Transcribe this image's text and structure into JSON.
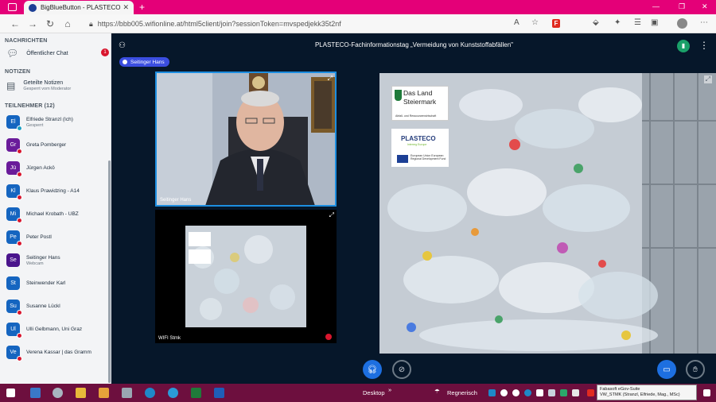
{
  "browser": {
    "tab_title": "BigBlueButton - PLASTECO -",
    "url": "https://bbb005.wifionline.at/html5client/join?sessionToken=mvspedjekk35t2nf"
  },
  "sidebar": {
    "messages_header": "NACHRICHTEN",
    "public_chat": "Öffentlicher Chat",
    "unread": "1",
    "notes_header": "NOTIZEN",
    "shared_notes": "Geteilte Notizen",
    "shared_notes_sub": "Gesperrt vom Moderator",
    "participants_header": "TEILNEHMER (12)",
    "users": [
      {
        "initials": "El",
        "name": "Elfriede Stranzl (Ich)",
        "sub": "Gesperrt",
        "color": "#1565c0",
        "mic": "on"
      },
      {
        "initials": "Gr",
        "name": "Greta Pomberger",
        "sub": "",
        "color": "#6a1b9a",
        "mic": "muted"
      },
      {
        "initials": "Jü",
        "name": "Jürgen Ackö",
        "sub": "",
        "color": "#6a1b9a",
        "mic": "muted"
      },
      {
        "initials": "Kl",
        "name": "Klaus Prawidzing - A14",
        "sub": "",
        "color": "#1565c0",
        "mic": "muted"
      },
      {
        "initials": "Mi",
        "name": "Michael Krobath - UBZ",
        "sub": "",
        "color": "#1565c0",
        "mic": "muted"
      },
      {
        "initials": "Pe",
        "name": "Peter Postl",
        "sub": "",
        "color": "#1565c0",
        "mic": "muted"
      },
      {
        "initials": "Se",
        "name": "Seitinger Hans",
        "sub": "Webcam",
        "color": "#4a148c",
        "mic": "none"
      },
      {
        "initials": "St",
        "name": "Steinwender Karl",
        "sub": "",
        "color": "#1565c0",
        "mic": "none"
      },
      {
        "initials": "Su",
        "name": "Susanne Lückl",
        "sub": "",
        "color": "#1565c0",
        "mic": "muted"
      },
      {
        "initials": "Ul",
        "name": "Ulli Gelbmann, Uni Graz",
        "sub": "",
        "color": "#1565c0",
        "mic": "muted"
      },
      {
        "initials": "Ve",
        "name": "Verena Kassar | das Gramm",
        "sub": "",
        "color": "#1565c0",
        "mic": "muted"
      }
    ]
  },
  "meeting": {
    "title": "PLASTECO-Fachinformationstag „Vermeidung von Kunststoffabfällen\"",
    "talking": "Seitinger Hans",
    "cam1_label": "Seitinger Hans",
    "cam2_label": "WIFI Stmk"
  },
  "presentation": {
    "logo1_title": "Das Land Steiermark",
    "logo1_sub": "Abfall- und Ressourcenwirtschaft",
    "logo2_title": "PLASTECO",
    "logo2_sub": "Interreg Europe",
    "logo2_eu": "European Union European Regional Development Fund"
  },
  "taskbar": {
    "desktop": "Desktop",
    "weather": "Regnerisch",
    "tooltip_line1": "Fabasoft eGov-Suite",
    "tooltip_line2": "VW_STMK (Stranzl, Elfriede, Mag., MSc)"
  }
}
